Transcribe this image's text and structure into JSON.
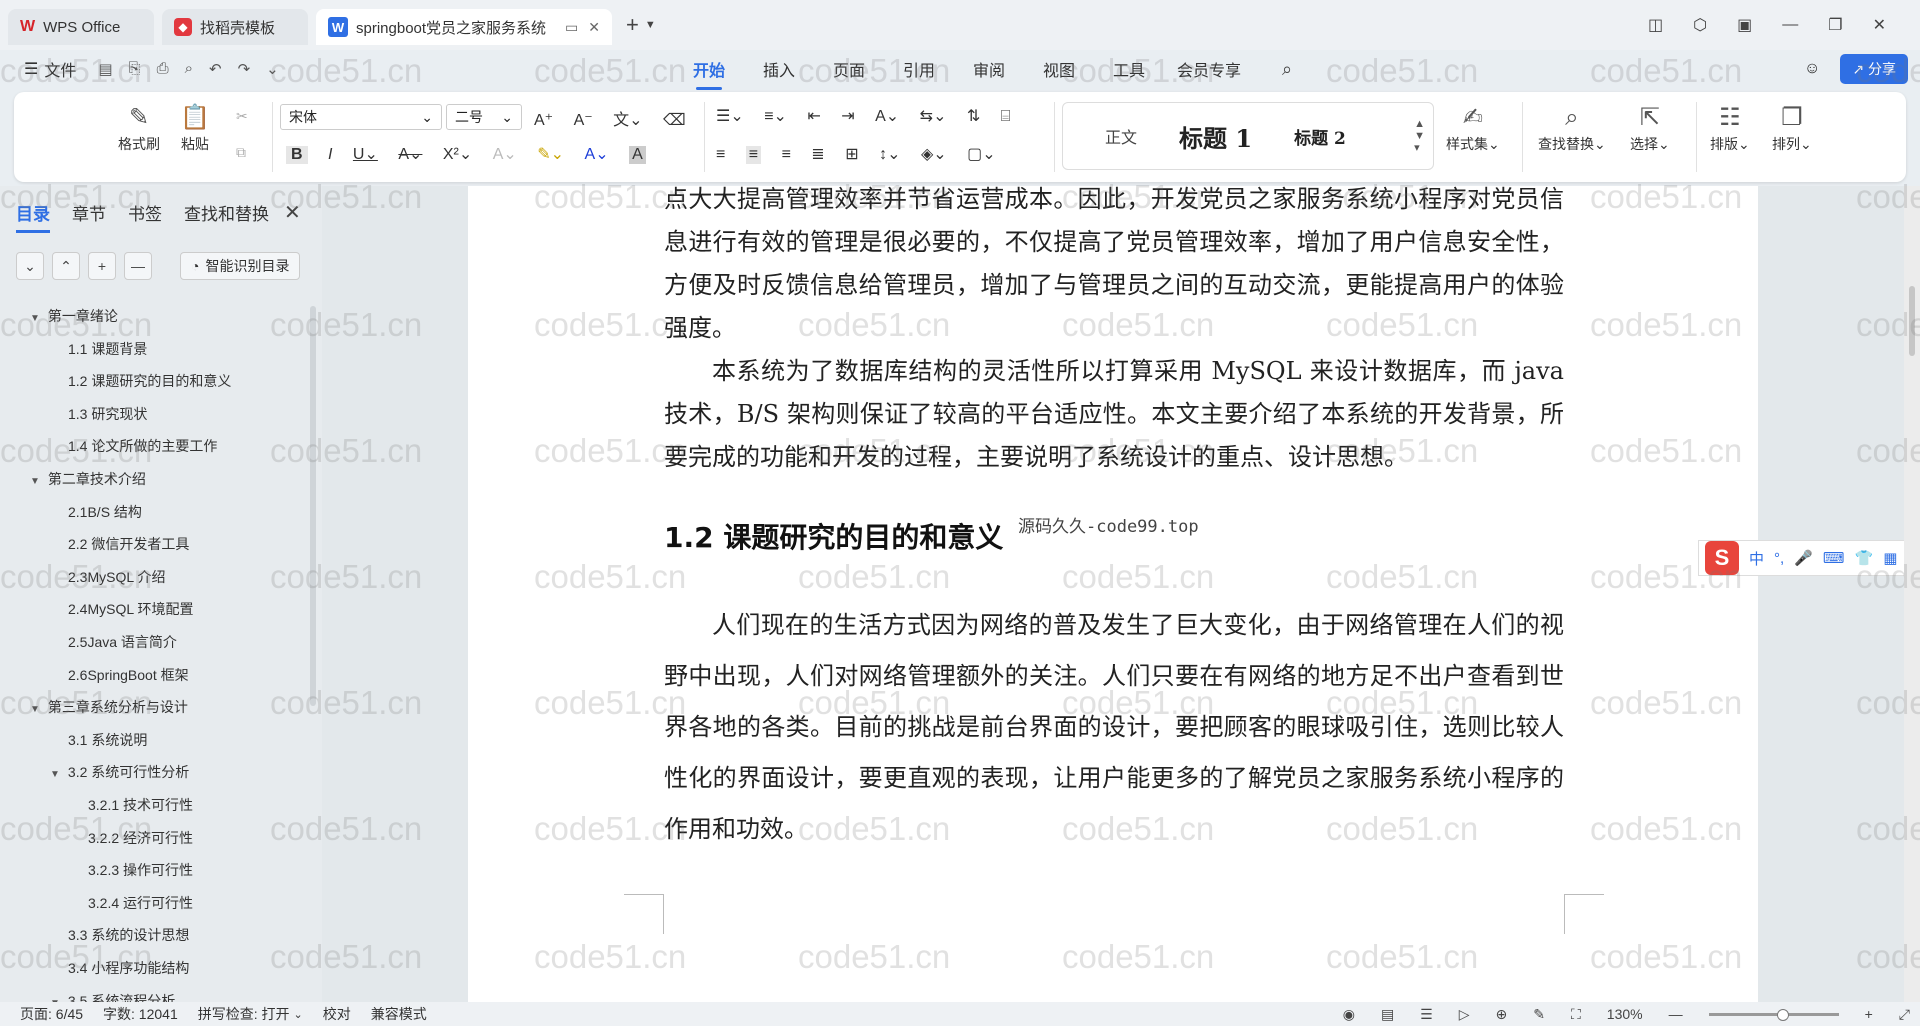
{
  "tabs": {
    "home": "WPS Office",
    "template": "找稻壳模板",
    "document": "springboot党员之家服务系统"
  },
  "menubar": {
    "file": "文件",
    "items": [
      "开始",
      "插入",
      "页面",
      "引用",
      "审阅",
      "视图",
      "工具",
      "会员专享"
    ],
    "share": "分享"
  },
  "ribbon": {
    "format_painter": "格式刷",
    "paste": "粘贴",
    "font_name": "宋体",
    "font_size": "二号",
    "styles": [
      "正文",
      "标题 1",
      "标题 2"
    ],
    "style_set": "样式集",
    "find_replace": "查找替换",
    "select": "选择",
    "layout": "排版",
    "arrange": "排列"
  },
  "left_panel": {
    "tabs": [
      "目录",
      "章节",
      "书签",
      "查找和替换"
    ],
    "smart_toc": "智能识别目录",
    "toc": [
      {
        "label": "第一章绪论",
        "level": 0,
        "expanded": true
      },
      {
        "label": "1.1 课题背景",
        "level": 1
      },
      {
        "label": "1.2 课题研究的目的和意义",
        "level": 1
      },
      {
        "label": "1.3  研究现状",
        "level": 1
      },
      {
        "label": "1.4 论文所做的主要工作",
        "level": 1
      },
      {
        "label": "第二章技术介绍",
        "level": 0,
        "expanded": true
      },
      {
        "label": "2.1B/S 结构",
        "level": 1
      },
      {
        "label": "2.2 微信开发者工具",
        "level": 1
      },
      {
        "label": "2.3MySQL 介绍",
        "level": 1
      },
      {
        "label": "2.4MySQL 环境配置",
        "level": 1
      },
      {
        "label": "2.5Java 语言简介",
        "level": 1
      },
      {
        "label": "2.6SpringBoot 框架",
        "level": 1
      },
      {
        "label": "第三章系统分析与设计",
        "level": 0,
        "expanded": true
      },
      {
        "label": "3.1 系统说明",
        "level": 1
      },
      {
        "label": "3.2 系统可行性分析",
        "level": 1,
        "expanded": true
      },
      {
        "label": "3.2.1  技术可行性",
        "level": 2
      },
      {
        "label": "3.2.2  经济可行性",
        "level": 2
      },
      {
        "label": "3.2.3 操作可行性",
        "level": 2
      },
      {
        "label": "3.2.4 运行可行性",
        "level": 2
      },
      {
        "label": "3.3 系统的设计思想",
        "level": 1
      },
      {
        "label": "3.4 小程序功能结构",
        "level": 1
      },
      {
        "label": "3.5 系统流程分析",
        "level": 1,
        "expanded": true
      }
    ]
  },
  "document": {
    "para1": "点大大提高管理效率并节省运营成本。因此，开发党员之家服务系统小程序对党员信息进行有效的管理是很必要的，不仅提高了党员管理效率，增加了用户信息安全性，方便及时反馈信息给管理员，增加了与管理员之间的互动交流，更能提高用户的体验强度。",
    "para2": "本系统为了数据库结构的灵活性所以打算采用 MySQL 来设计数据库，而 java 技术，B/S 架构则保证了较高的平台适应性。本文主要介绍了本系统的开发背景，所要完成的功能和开发的过程，主要说明了系统设计的重点、设计思想。",
    "heading": "1.2 课题研究的目的和意义",
    "overlay_text": "源码久久-code99.top",
    "para3": "人们现在的生活方式因为网络的普及发生了巨大变化，由于网络管理在人们的视野中出现，人们对网络管理额外的关注。人们只要在有网络的地方足不出户查看到世界各地的各类。目前的挑战是前台界面的设计，要把顾客的眼球吸引住，选则比较人性化的界面设计，要更直观的表现，让用户能更多的了解党员之家服务系统小程序的作用和功效。"
  },
  "ime": {
    "mode": "中"
  },
  "watermark_text": "code51.cn",
  "status": {
    "page": "页面: 6/45",
    "words": "字数: 12041",
    "spell": "拼写检查: 打开",
    "proof": "校对",
    "compat": "兼容模式",
    "zoom": "130%"
  },
  "colors": {
    "accent": "#2f6fe4",
    "wps_red": "#d6242a"
  }
}
